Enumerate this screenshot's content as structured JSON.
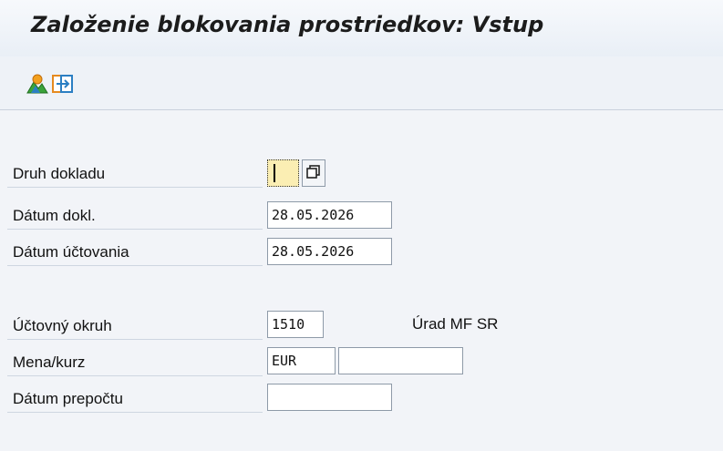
{
  "window": {
    "title": "Založenie blokovania prostriedkov: Vstup"
  },
  "toolbar": {
    "icons": [
      "execute-icon",
      "other-document-icon"
    ]
  },
  "form": {
    "doc_type": {
      "label": "Druh dokladu",
      "value": ""
    },
    "doc_date": {
      "label": "Dátum dokl.",
      "value": "28.05.2026"
    },
    "posting_date": {
      "label": "Dátum účtovania",
      "value": "28.05.2026"
    },
    "company_code": {
      "label": "Účtovný okruh",
      "value": "1510",
      "description": "Úrad MF SR"
    },
    "currency": {
      "label": "Mena/kurz",
      "value": "EUR",
      "rate": ""
    },
    "translation_date": {
      "label": "Dátum prepočtu",
      "value": ""
    }
  },
  "colors": {
    "field_focus": "#fbeeb3",
    "background": "#eef2f7"
  }
}
